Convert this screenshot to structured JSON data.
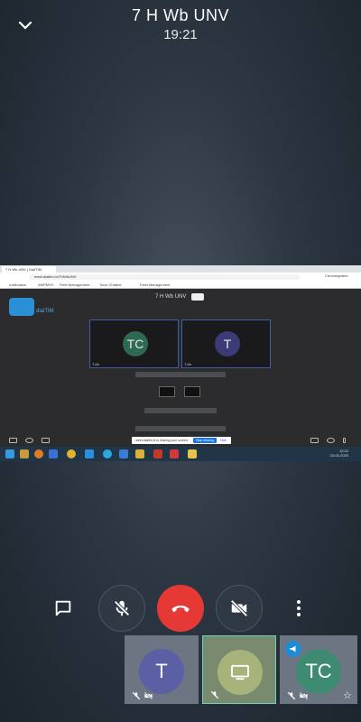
{
  "header": {
    "title": "7 H Wb UNV",
    "time": "19:21",
    "collapse_icon": "chevron-down-icon"
  },
  "shared_screen": {
    "browser_tab": "7 H Wb UNV | DiaiTIM",
    "address": "meet.diaitim.in/7HWbUNV",
    "bookmarks": [
      "notification",
      "AMPMVV",
      "Fleet Management...",
      "Tonic Chatbot",
      "Fleet Management"
    ],
    "profile": "Chromegraber",
    "app_logo_text": "diaiTIM",
    "meeting_title": "7 H Wb UNV",
    "tiles": [
      {
        "initials": "TC",
        "color": "#2e6a52",
        "label": "T.Ab"
      },
      {
        "initials": "T",
        "color": "#3d3a78",
        "label": "T.Ab"
      }
    ],
    "share_message": "meet.diaitim.in is sharing your screen.",
    "stop_sharing": "Stop sharing",
    "hide": "Hide",
    "clock_time": "12:22",
    "clock_date": "23-05-2020"
  },
  "controls": {
    "chat_icon": "chat-icon",
    "mic_icon": "mic-off-icon",
    "hangup_icon": "end-call-icon",
    "camera_icon": "camera-off-icon",
    "more_icon": "more-vert-icon"
  },
  "participants": [
    {
      "initials": "T",
      "color": "#5b5fa4",
      "active": false
    },
    {
      "initials": "",
      "color": "#a6b37a",
      "active": true,
      "icon": "screen-share-icon"
    },
    {
      "initials": "TC",
      "color": "#3f8a72",
      "active": false,
      "speaker": true
    }
  ]
}
